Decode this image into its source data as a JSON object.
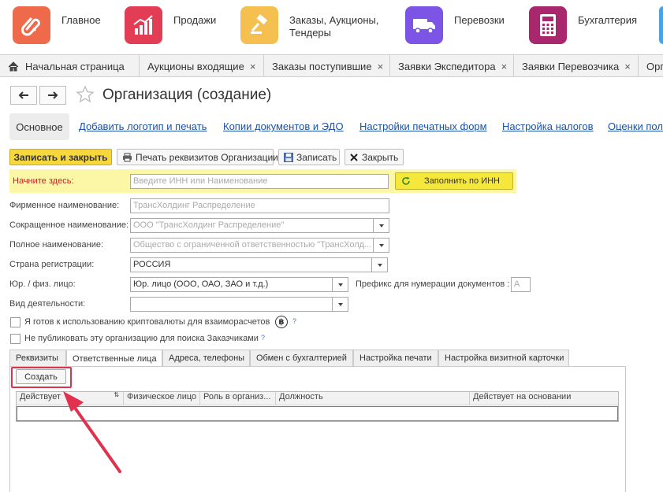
{
  "sections": [
    {
      "label": "Главное",
      "icon": "paperclip-icon",
      "color": "#ee6a4b"
    },
    {
      "label": "Продажи",
      "icon": "chart-icon",
      "color": "#e23d55"
    },
    {
      "label": "Заказы,  Аукционы,\nТендеры",
      "icon": "gavel-icon",
      "color": "#f5c04f"
    },
    {
      "label": "Перевозки",
      "icon": "truck-icon",
      "color": "#7c55e6"
    },
    {
      "label": "Бухгалтерия",
      "icon": "calculator-icon",
      "color": "#a8276d"
    }
  ],
  "tabs": [
    {
      "label": "Начальная страница"
    },
    {
      "label": "Аукционы входящие",
      "close": "×"
    },
    {
      "label": "Заказы поступившие",
      "close": "×"
    },
    {
      "label": "Заявки Экспедитора",
      "close": "×"
    },
    {
      "label": "Заявки Перевозчика",
      "close": "×"
    },
    {
      "label": "Орг"
    }
  ],
  "form": {
    "title": "Организация (создание)",
    "nav": {
      "active": "Основное",
      "links": [
        "Добавить логотип и печать",
        "Копии документов и ЭДО",
        "Настройки печатных форм",
        "Настройка налогов",
        "Оценки пол"
      ]
    },
    "commands": {
      "save_close": "Записать и закрыть",
      "print": "Печать реквизитов Организации",
      "save": "Записать",
      "close": "Закрыть"
    },
    "start": {
      "label": "Начните здесь:",
      "placeholder": "Введите ИНН или Наименование",
      "fill_button": "Заполнить по ИНН"
    },
    "fields": {
      "firm_label": "Фирменное наименование:",
      "firm_placeholder": "ТрансХолдинг Распределение",
      "short_label": "Сокращенное наименование:",
      "short_placeholder": "ООО \"ТрансХолдинг Распределение\"",
      "full_label": "Полное наименование:",
      "full_placeholder": "Общество с ограниченной ответственностью \"ТрансХолд...",
      "country_label": "Страна регистрации:",
      "country_value": "РОССИЯ",
      "entity_label": "Юр. / физ. лицо:",
      "entity_value": "Юр. лицо (ООО, ОАО, ЗАО и т.д.)",
      "prefix_label": "Префикс для нумерации документов :",
      "prefix_placeholder": "А",
      "activity_label": "Вид деятельности:",
      "activity_value": ""
    },
    "checks": {
      "crypto": "Я готов к использованию криптовалюты для взаиморасчетов",
      "no_publish": "Не публиковать эту организацию для поиска Заказчиками",
      "help": "?"
    },
    "lower_tabs": [
      "Реквизиты",
      "Ответственные лица",
      "Адреса, телефоны",
      "Обмен с бухгалтерией",
      "Настройка печати",
      "Настройка визитной карточки"
    ],
    "create_button": "Создать",
    "table_columns": [
      "Действует",
      "Физическое лицо",
      "Роль в организ...",
      "Должность",
      "Действует на основании"
    ]
  },
  "colors": {
    "highlight": "#e0324f",
    "link": "#1b52a7",
    "primary": "#f6d73c",
    "start_panel": "#fbf7a7"
  }
}
